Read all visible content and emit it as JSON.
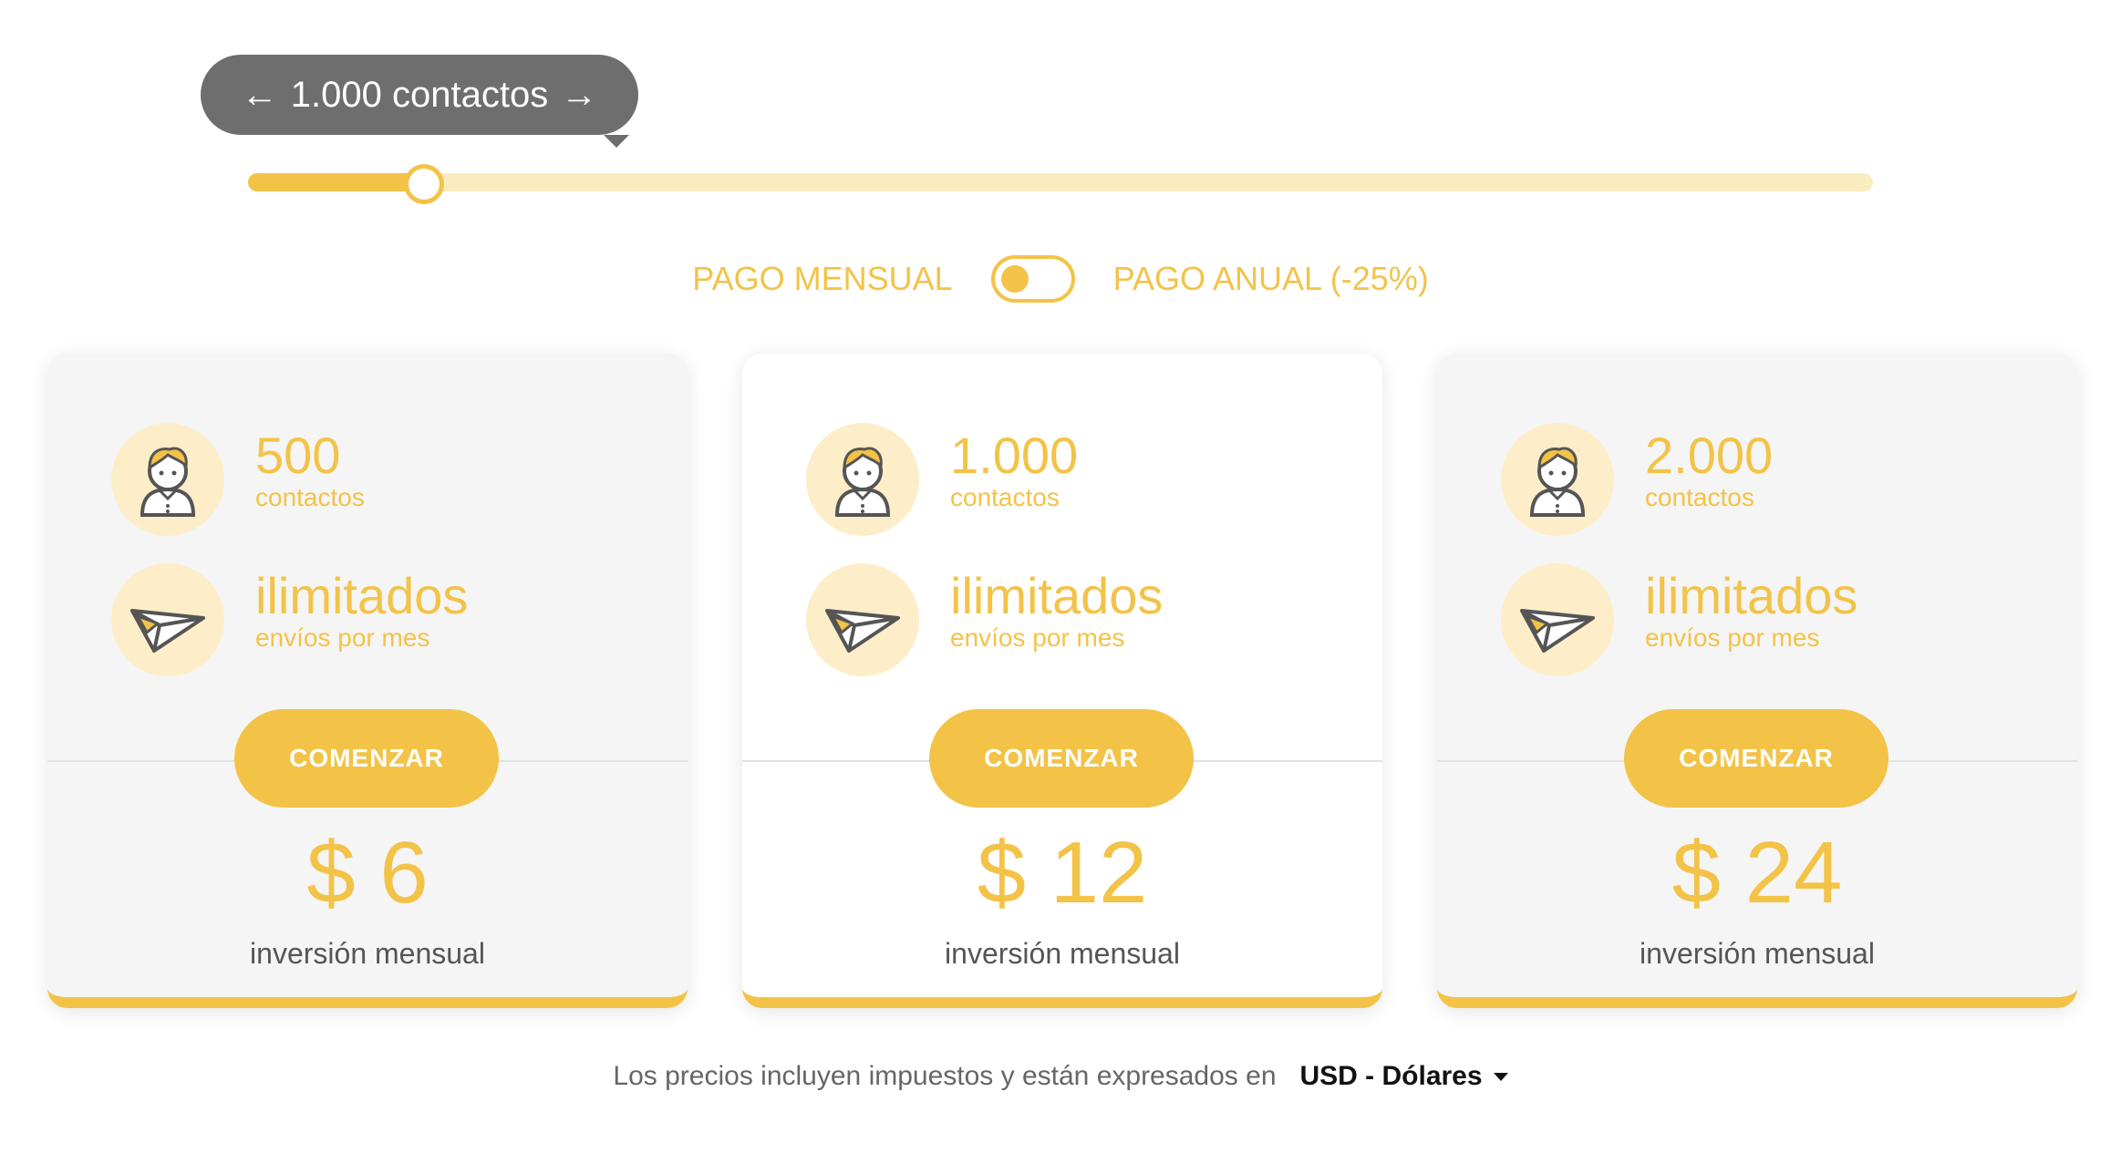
{
  "slider": {
    "tooltip_label": "1.000 contactos",
    "left_arrow": "←",
    "right_arrow": "→",
    "position": 0.107
  },
  "billing": {
    "monthly_label": "PAGO MENSUAL",
    "annual_label": "PAGO ANUAL (-25%)",
    "annual_selected": false
  },
  "plans": [
    {
      "contacts_value": "500",
      "contacts_label": "contactos",
      "sends_value": "ilimitados",
      "sends_label": "envíos por mes",
      "button_label": "COMENZAR",
      "price": "$ 6",
      "price_label": "inversión mensual",
      "featured": false
    },
    {
      "contacts_value": "1.000",
      "contacts_label": "contactos",
      "sends_value": "ilimitados",
      "sends_label": "envíos por mes",
      "button_label": "COMENZAR",
      "price": "$ 12",
      "price_label": "inversión mensual",
      "featured": true
    },
    {
      "contacts_value": "2.000",
      "contacts_label": "contactos",
      "sends_value": "ilimitados",
      "sends_label": "envíos por mes",
      "button_label": "COMENZAR",
      "price": "$ 24",
      "price_label": "inversión mensual",
      "featured": false
    }
  ],
  "footer": {
    "note": "Los precios incluyen impuestos y están expresados en",
    "currency": "USD - Dólares"
  },
  "colors": {
    "accent": "#f3c348",
    "accent_light": "#fbecc0",
    "icon_bg": "#fdeec9",
    "tooltip_bg": "#6e6e6e"
  },
  "icons": {
    "contacts": "user-icon",
    "sends": "paper-plane-icon"
  }
}
